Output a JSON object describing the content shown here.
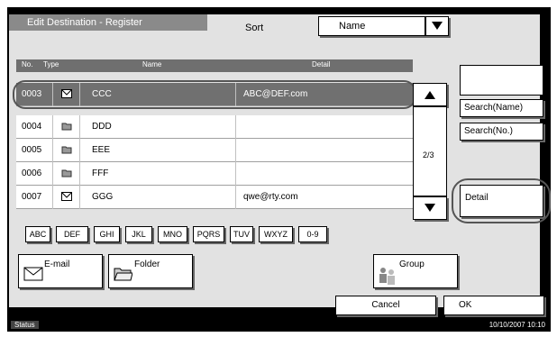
{
  "window": {
    "title": "Edit Destination - Register"
  },
  "sort": {
    "label": "Sort",
    "value": "Name"
  },
  "columns": {
    "no": "No.",
    "type": "Type",
    "name": "Name",
    "detail": "Detail"
  },
  "rows": [
    {
      "no": "0003",
      "type": "email-icon",
      "name": "CCC",
      "detail": "ABC@DEF.com",
      "selected": true
    },
    {
      "no": "0004",
      "type": "folder-icon",
      "name": "DDD",
      "detail": "",
      "selected": false
    },
    {
      "no": "0005",
      "type": "folder-icon",
      "name": "EEE",
      "detail": "",
      "selected": false
    },
    {
      "no": "0006",
      "type": "folder-icon",
      "name": "FFF",
      "detail": "",
      "selected": false
    },
    {
      "no": "0007",
      "type": "email-icon",
      "name": "GGG",
      "detail": "qwe@rty.com",
      "selected": false
    }
  ],
  "page": "2/3",
  "buttons": {
    "search_name": "Search(Name)",
    "search_no": "Search(No.)",
    "detail": "Detail",
    "email": "E-mail",
    "folder": "Folder",
    "group": "Group",
    "cancel": "Cancel",
    "ok": "OK"
  },
  "alpha": [
    "ABC",
    "DEF",
    "GHI",
    "JKL",
    "MNO",
    "PQRS",
    "TUV",
    "WXYZ",
    "0-9"
  ],
  "status": {
    "label": "Status",
    "datetime": "10/10/2007  10:10"
  },
  "colors": {
    "panel": "#e2e2e2",
    "selected_row": "#707070",
    "header": "#6f6f6f"
  }
}
